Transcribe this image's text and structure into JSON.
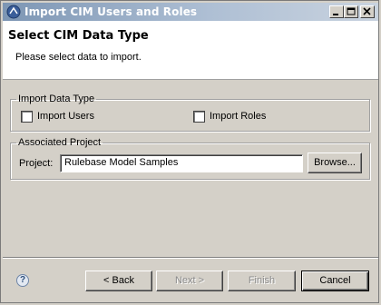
{
  "window": {
    "title": "Import CIM Users and Roles"
  },
  "header": {
    "title": "Select CIM Data Type",
    "description": "Please select data to import."
  },
  "import_type": {
    "legend": "Import Data Type",
    "users_label": "Import Users",
    "users_checked": false,
    "roles_label": "Import Roles",
    "roles_checked": false
  },
  "project": {
    "legend": "Associated Project",
    "label": "Project:",
    "value": "Rulebase Model Samples",
    "browse_label": "Browse..."
  },
  "footer": {
    "help_glyph": "?",
    "back_label": "< Back",
    "next_label": "Next >",
    "finish_label": "Finish",
    "cancel_label": "Cancel"
  }
}
